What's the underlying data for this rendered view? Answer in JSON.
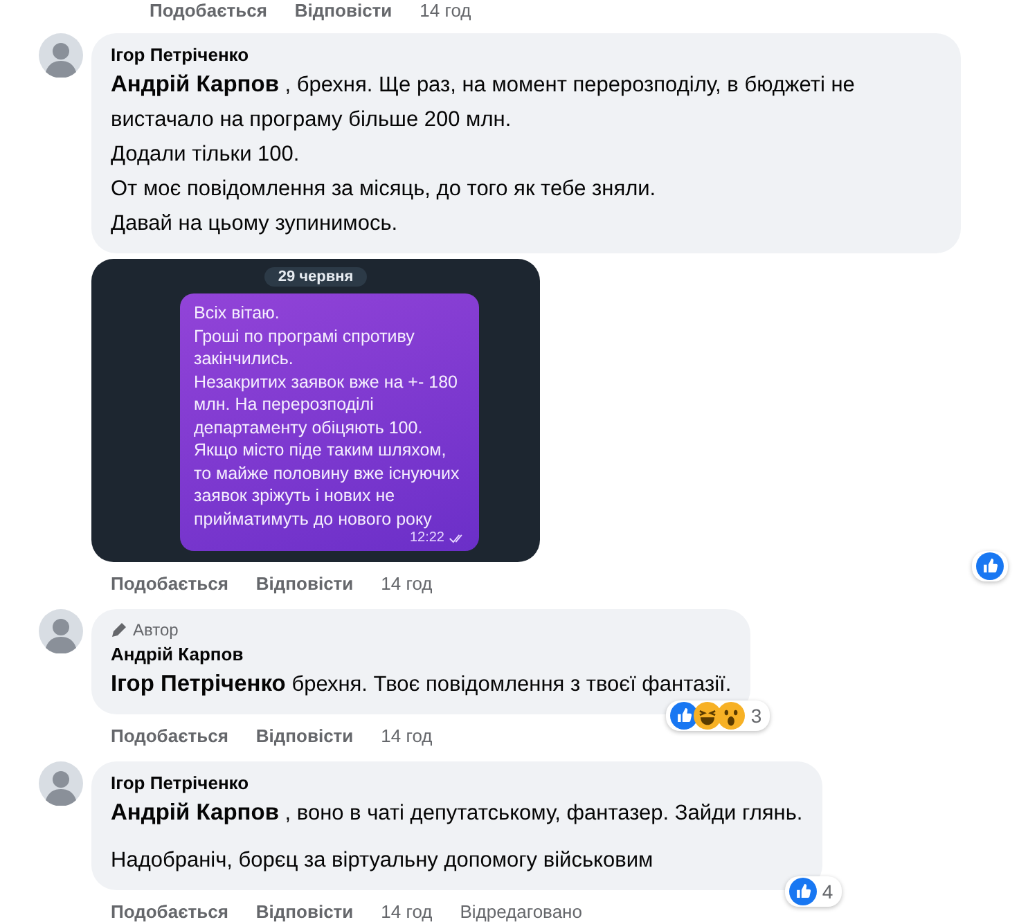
{
  "previous_actions": {
    "like": "Подобається",
    "reply": "Відповісти",
    "time": "14 год"
  },
  "comments": [
    {
      "author": "Ігор Петріченко",
      "paragraphs": [
        [
          "**Андрій Карпов** , брехня. Ще раз, на момент перерозподілу, в бюджеті не вистачало на програму більше 200 млн.",
          "Додали тільки 100.",
          "От моє повідомлення за місяць, до того як тебе зняли.",
          "Давай на цьому зупинимось."
        ]
      ],
      "attachment": {
        "kind": "chat_screenshot",
        "date": "29 червня",
        "message": [
          "Всіх вітаю.",
          "Гроші по програмі спротиву закінчились.",
          "Незакритих заявок вже на +- 180 млн. На перерозподілі департаменту обіцяють 100.",
          "Якщо місто піде таким шляхом, то майже половину вже існуючих заявок зріжуть і нових не прийматимуть до нового року"
        ],
        "time": "12:22",
        "read": true
      },
      "actions": {
        "like": "Подобається",
        "reply": "Відповісти",
        "time": "14 год"
      },
      "reactions": {
        "kind": "beside",
        "icons": [
          {
            "kind": "like"
          }
        ]
      }
    },
    {
      "author": "Андрій Карпов",
      "author_badge": "Автор",
      "paragraphs": [
        [
          "**Ігор Петріченко** брехня. Твоє повідомлення з твоєї фантазії."
        ]
      ],
      "actions": {
        "like": "Подобається",
        "reply": "Відповісти",
        "time": "14 год"
      },
      "reactions": {
        "kind": "on_bubble",
        "icons": [
          {
            "kind": "like"
          },
          {
            "kind": "haha"
          },
          {
            "kind": "wow"
          }
        ],
        "count": "3"
      }
    },
    {
      "author": "Ігор Петріченко",
      "paragraphs": [
        [
          "**Андрій Карпов** , воно в чаті депутатському, фантазер. Зайди глянь."
        ],
        [
          "Надобраніч, борєц за віртуальну допомогу військовим"
        ]
      ],
      "actions": {
        "like": "Подобається",
        "reply": "Відповісти",
        "time": "14 год",
        "edited": "Відредаговано"
      },
      "reactions": {
        "kind": "on_bubble",
        "icons": [
          {
            "kind": "like"
          }
        ],
        "count": "4"
      }
    }
  ]
}
